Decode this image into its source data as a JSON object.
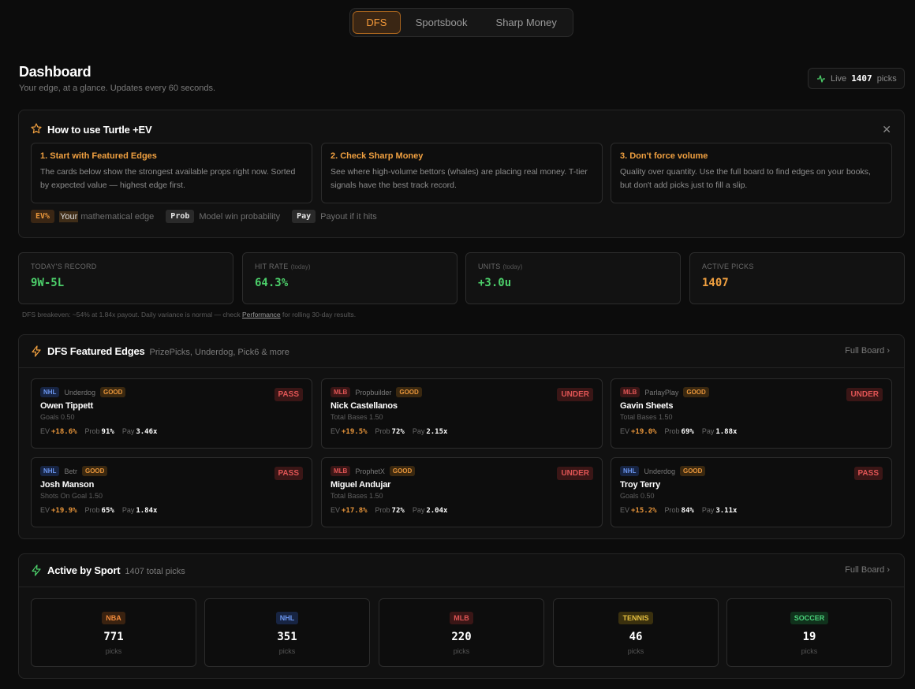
{
  "nav": {
    "tabs": [
      "DFS",
      "Sportsbook",
      "Sharp Money"
    ],
    "active": "DFS"
  },
  "header": {
    "title": "Dashboard",
    "subtitle": "Your edge, at a glance. Updates every 60 seconds.",
    "live_label": "Live",
    "live_count": "1407",
    "live_suffix": "picks"
  },
  "howto": {
    "title": "How to use Turtle +EV",
    "steps": [
      {
        "title": "1. Start with Featured Edges",
        "body": "The cards below show the strongest available props right now. Sorted by expected value — highest edge first."
      },
      {
        "title": "2. Check Sharp Money",
        "body": "See where high-volume bettors (whales) are placing real money. T-tier signals have the best track record."
      },
      {
        "title": "3. Don't force volume",
        "body": "Quality over quantity. Use the full board to find edges on your books, but don't add picks just to fill a slip."
      }
    ],
    "legend": [
      {
        "chip": "EV%",
        "text_highlight": "Your",
        "text": " mathematical edge"
      },
      {
        "chip": "Prob",
        "text": "Model win probability"
      },
      {
        "chip": "Pay",
        "text": "Payout if it hits"
      }
    ]
  },
  "stats": [
    {
      "label": "TODAY'S RECORD",
      "sub": "",
      "value": "9W-5L",
      "color": "#4ccf6a"
    },
    {
      "label": "HIT RATE",
      "sub": "(today)",
      "value": "64.3%",
      "color": "#4ccf6a"
    },
    {
      "label": "UNITS",
      "sub": "(today)",
      "value": "+3.0u",
      "color": "#4ccf6a"
    },
    {
      "label": "ACTIVE PICKS",
      "sub": "",
      "value": "1407",
      "color": "#f0a040"
    }
  ],
  "note": {
    "before": "DFS breakeven: ~54% at 1.84x payout. Daily variance is normal — check ",
    "link": "Performance",
    "after": " for rolling 30-day results."
  },
  "featured": {
    "title": "DFS Featured Edges",
    "subtitle": "PrizePicks, Underdog, Pick6 & more",
    "full_board": "Full Board",
    "cards": [
      {
        "sport": "NHL",
        "book": "Underdog",
        "grade": "GOOD",
        "player": "Owen Tippett",
        "prop": "Goals 0.50",
        "ev": "+18.6%",
        "prob": "91%",
        "pay": "3.46x",
        "verdict": "PASS"
      },
      {
        "sport": "MLB",
        "book": "Propbuilder",
        "grade": "GOOD",
        "player": "Nick Castellanos",
        "prop": "Total Bases 1.50",
        "ev": "+19.5%",
        "prob": "72%",
        "pay": "2.15x",
        "verdict": "UNDER"
      },
      {
        "sport": "MLB",
        "book": "ParlayPlay",
        "grade": "GOOD",
        "player": "Gavin Sheets",
        "prop": "Total Bases 1.50",
        "ev": "+19.0%",
        "prob": "69%",
        "pay": "1.88x",
        "verdict": "UNDER"
      },
      {
        "sport": "NHL",
        "book": "Betr",
        "grade": "GOOD",
        "player": "Josh Manson",
        "prop": "Shots On Goal 1.50",
        "ev": "+19.9%",
        "prob": "65%",
        "pay": "1.84x",
        "verdict": "PASS"
      },
      {
        "sport": "MLB",
        "book": "ProphetX",
        "grade": "GOOD",
        "player": "Miguel Andujar",
        "prop": "Total Bases 1.50",
        "ev": "+17.8%",
        "prob": "72%",
        "pay": "2.04x",
        "verdict": "UNDER"
      },
      {
        "sport": "NHL",
        "book": "Underdog",
        "grade": "GOOD",
        "player": "Troy Terry",
        "prop": "Goals 0.50",
        "ev": "+15.2%",
        "prob": "84%",
        "pay": "3.11x",
        "verdict": "PASS"
      }
    ],
    "labels": {
      "ev": "EV",
      "prob": "Prob",
      "pay": "Pay"
    }
  },
  "sports": {
    "title": "Active by Sport",
    "subtitle": "1407 total picks",
    "full_board": "Full Board",
    "items": [
      {
        "sport": "NBA",
        "count": "771",
        "unit": "picks"
      },
      {
        "sport": "NHL",
        "count": "351",
        "unit": "picks"
      },
      {
        "sport": "MLB",
        "count": "220",
        "unit": "picks"
      },
      {
        "sport": "TENNIS",
        "count": "46",
        "unit": "picks"
      },
      {
        "sport": "SOCCER",
        "count": "19",
        "unit": "picks"
      }
    ]
  }
}
